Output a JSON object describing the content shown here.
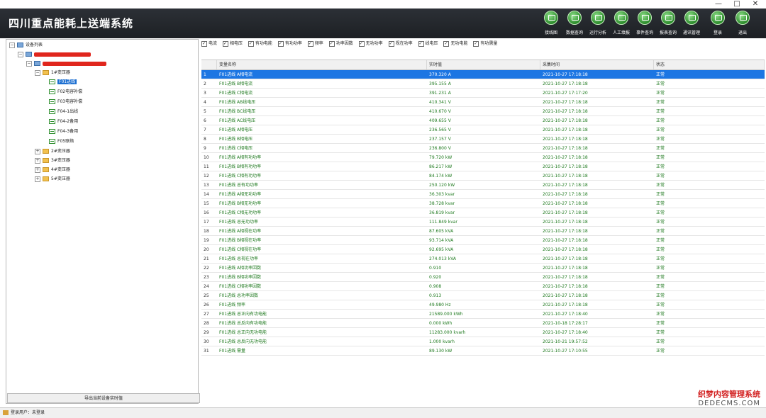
{
  "window": {
    "controls": [
      "—",
      "□",
      "✕"
    ]
  },
  "app": {
    "title": "四川重点能耗上送端系统"
  },
  "toolbar": [
    {
      "label": "接线图",
      "icon": "wiring-diagram-icon"
    },
    {
      "label": "数据查询",
      "icon": "data-query-icon"
    },
    {
      "label": "运行分析",
      "icon": "analysis-icon"
    },
    {
      "label": "人工填报",
      "icon": "manual-entry-icon"
    },
    {
      "label": "事件查询",
      "icon": "event-query-icon"
    },
    {
      "label": "报表查询",
      "icon": "report-query-icon"
    },
    {
      "label": "通讯管理",
      "icon": "comm-management-icon"
    },
    {
      "label": "登录",
      "icon": "login-icon"
    },
    {
      "label": "退出",
      "icon": "exit-icon"
    }
  ],
  "tree": {
    "root": "设备列表",
    "transformer1": "1#变压器",
    "feeders": [
      "F01进线",
      "F02电容补偿",
      "F03电容补偿",
      "F04-1出线",
      "F04-2备用",
      "F04-3备用",
      "F05联络"
    ],
    "others": [
      "2#变压器",
      "3#变压器",
      "4#变压器",
      "5#变压器"
    ],
    "export_button": "导出当前设备实时值"
  },
  "filters": [
    "电流",
    "相电压",
    "有功电能",
    "有功功率",
    "频率",
    "功率因数",
    "无功功率",
    "视在功率",
    "线电压",
    "无功电能",
    "有功需量"
  ],
  "grid": {
    "columns": [
      "变量名称",
      "实时值",
      "采集时间",
      "状态"
    ],
    "rows": [
      {
        "n": "1",
        "name": "F01进线 A相电流",
        "value": "370.320 A",
        "time": "2021-10-27 17:18:18",
        "status": "正常"
      },
      {
        "n": "2",
        "name": "F01进线 B相电流",
        "value": "395.155 A",
        "time": "2021-10-27 17:18:18",
        "status": "正常"
      },
      {
        "n": "3",
        "name": "F01进线 C相电流",
        "value": "391.231 A",
        "time": "2021-10-27 17:17:20",
        "status": "正常"
      },
      {
        "n": "4",
        "name": "F01进线 AB线电压",
        "value": "410.341 V",
        "time": "2021-10-27 17:18:18",
        "status": "正常"
      },
      {
        "n": "5",
        "name": "F01进线 BC线电压",
        "value": "410.670 V",
        "time": "2021-10-27 17:18:18",
        "status": "正常"
      },
      {
        "n": "6",
        "name": "F01进线 AC线电压",
        "value": "409.655 V",
        "time": "2021-10-27 17:18:18",
        "status": "正常"
      },
      {
        "n": "7",
        "name": "F01进线 A相电压",
        "value": "236.565 V",
        "time": "2021-10-27 17:18:18",
        "status": "正常"
      },
      {
        "n": "8",
        "name": "F01进线 B相电压",
        "value": "237.157 V",
        "time": "2021-10-27 17:18:18",
        "status": "正常"
      },
      {
        "n": "9",
        "name": "F01进线 C相电压",
        "value": "236.800 V",
        "time": "2021-10-27 17:18:18",
        "status": "正常"
      },
      {
        "n": "10",
        "name": "F01进线 A相有功功率",
        "value": "79.720 kW",
        "time": "2021-10-27 17:18:18",
        "status": "正常"
      },
      {
        "n": "11",
        "name": "F01进线 B相有功功率",
        "value": "86.217 kW",
        "time": "2021-10-27 17:18:18",
        "status": "正常"
      },
      {
        "n": "12",
        "name": "F01进线 C相有功功率",
        "value": "84.174 kW",
        "time": "2021-10-27 17:18:18",
        "status": "正常"
      },
      {
        "n": "13",
        "name": "F01进线 总有功功率",
        "value": "250.120 kW",
        "time": "2021-10-27 17:18:18",
        "status": "正常"
      },
      {
        "n": "14",
        "name": "F01进线 A相无功功率",
        "value": "36.303 kvar",
        "time": "2021-10-27 17:18:18",
        "status": "正常"
      },
      {
        "n": "15",
        "name": "F01进线 B相无功功率",
        "value": "38.728 kvar",
        "time": "2021-10-27 17:18:18",
        "status": "正常"
      },
      {
        "n": "16",
        "name": "F01进线 C相无功功率",
        "value": "36.819 kvar",
        "time": "2021-10-27 17:18:18",
        "status": "正常"
      },
      {
        "n": "17",
        "name": "F01进线 总无功功率",
        "value": "111.849 kvar",
        "time": "2021-10-27 17:18:18",
        "status": "正常"
      },
      {
        "n": "18",
        "name": "F01进线 A相视在功率",
        "value": "87.605 kVA",
        "time": "2021-10-27 17:18:18",
        "status": "正常"
      },
      {
        "n": "19",
        "name": "F01进线 B相视在功率",
        "value": "93.714 kVA",
        "time": "2021-10-27 17:18:18",
        "status": "正常"
      },
      {
        "n": "20",
        "name": "F01进线 C相视在功率",
        "value": "92.695 kVA",
        "time": "2021-10-27 17:18:18",
        "status": "正常"
      },
      {
        "n": "21",
        "name": "F01进线 总视在功率",
        "value": "274.013 kVA",
        "time": "2021-10-27 17:18:18",
        "status": "正常"
      },
      {
        "n": "22",
        "name": "F01进线 A相功率因数",
        "value": "0.910",
        "time": "2021-10-27 17:18:18",
        "status": "正常"
      },
      {
        "n": "23",
        "name": "F01进线 B相功率因数",
        "value": "0.920",
        "time": "2021-10-27 17:18:18",
        "status": "正常"
      },
      {
        "n": "24",
        "name": "F01进线 C相功率因数",
        "value": "0.908",
        "time": "2021-10-27 17:18:18",
        "status": "正常"
      },
      {
        "n": "25",
        "name": "F01进线 总功率因数",
        "value": "0.913",
        "time": "2021-10-27 17:18:18",
        "status": "正常"
      },
      {
        "n": "26",
        "name": "F01进线 频率",
        "value": "49.980 Hz",
        "time": "2021-10-27 17:18:18",
        "status": "正常"
      },
      {
        "n": "27",
        "name": "F01进线 总正向有功电能",
        "value": "21589.000 kWh",
        "time": "2021-10-27 17:18:40",
        "status": "正常"
      },
      {
        "n": "28",
        "name": "F01进线 总反向有功电能",
        "value": "0.000 kWh",
        "time": "2021-10-18 17:28:17",
        "status": "正常"
      },
      {
        "n": "29",
        "name": "F01进线 总正向无功电能",
        "value": "11283.000 kvarh",
        "time": "2021-10-27 17:18:40",
        "status": "正常"
      },
      {
        "n": "30",
        "name": "F01进线 总反向无功电能",
        "value": "1.000 kvarh",
        "time": "2021-10-21 19:57:52",
        "status": "正常"
      },
      {
        "n": "31",
        "name": "F01进线 需量",
        "value": "89.130 kW",
        "time": "2021-10-27 17:10:55",
        "status": "正常"
      }
    ]
  },
  "statusbar": {
    "text": "登录用户：未登录"
  },
  "watermark": {
    "line1": "织梦内容管理系统",
    "line2": "DEDECMS.COM"
  }
}
